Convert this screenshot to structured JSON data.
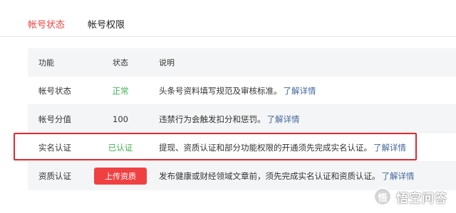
{
  "tabs": [
    {
      "label": "帐号状态",
      "active": true
    },
    {
      "label": "帐号权限",
      "active": false
    }
  ],
  "table": {
    "headers": [
      "功能",
      "状态",
      "说明"
    ],
    "rows": [
      {
        "feature": "帐号状态",
        "status": "正常",
        "desc": "头条号资料填写规范及审核标准。",
        "link": "了解详情"
      },
      {
        "feature": "帐号分值",
        "status": "100",
        "desc": "违禁行为会触发扣分和惩罚。",
        "link": "了解详情"
      },
      {
        "feature": "实名认证",
        "status": "已认证",
        "desc": "提现、资质认证和部分功能权限的开通须先完成实名认证。",
        "link": "了解详情"
      },
      {
        "feature": "资质认证",
        "status_button": "上传资质",
        "desc": "发布健康或财经领域文章前，须先完成实名认证和资质认证。",
        "link": "了解详情"
      }
    ]
  },
  "colors": {
    "accent": "#f04142",
    "status_ok": "#3fb34f",
    "link": "#406599",
    "highlight_border": "#e7262c"
  },
  "watermark": {
    "text": "悟空问答",
    "icon": "wukong-logo-icon"
  }
}
